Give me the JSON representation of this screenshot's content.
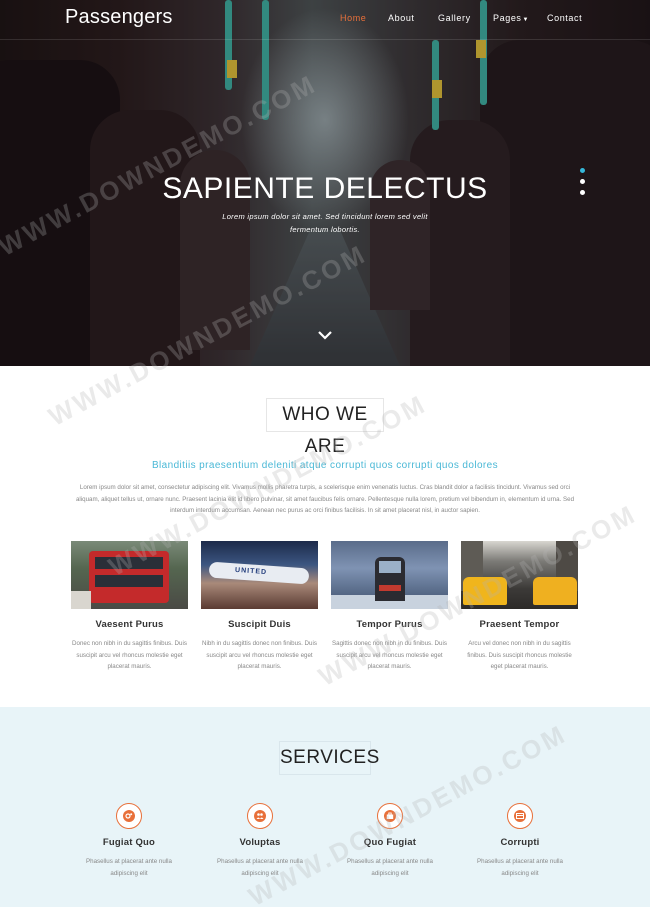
{
  "brand": "Passengers",
  "nav": [
    {
      "label": "Home",
      "active": true
    },
    {
      "label": "About",
      "active": false
    },
    {
      "label": "Gallery",
      "active": false
    },
    {
      "label": "Pages",
      "active": false,
      "has_dropdown": true
    },
    {
      "label": "Contact",
      "active": false
    }
  ],
  "hero": {
    "title": "SAPIENTE DELECTUS",
    "subtitle": "Lorem ipsum dolor sit amet. Sed tincidunt lorem sed velit fermentum lobortis.",
    "slide_dots": 3,
    "active_dot": 0,
    "scroll_icon": "chevron-down-icon"
  },
  "about": {
    "title": "WHO WE ARE",
    "lead": "Blanditiis praesentium deleniti atque corrupti quos corrupti quos dolores",
    "text": "Lorem ipsum dolor sit amet, consectetur adipiscing elit. Vivamus mollis pharetra turpis, a scelerisque enim venenatis luctus. Cras blandit dolor a facilisis tincidunt. Vivamus sed orci aliquam, aliquet tellus ut, ornare nunc. Praesent lacinia elit id libero pulvinar, sit amet faucibus felis ornare. Pellentesque nulla lorem, pretium vel bibendum in, elementum id urna. Sed interdum interdum accumsan. Aenean nec purus ac orci finibus facilisis. In sit amet placerat nisl, in auctor sapien.",
    "cards": [
      {
        "name": "Vaesent Purus",
        "desc": "Donec non nibh in du sagittis finibus. Duis suscipit arcu vel rhoncus molestie eget placerat mauris.",
        "image": "bus"
      },
      {
        "name": "Suscipit Duis",
        "desc": "Nibh in du sagittis donec non finibus. Duis suscipit arcu vel rhoncus molestie eget placerat mauris.",
        "image": "plane",
        "image_text": "UNITED"
      },
      {
        "name": "Tempor Purus",
        "desc": "Sagittis donec non nibh in du finibus. Duis suscipit arcu vel rhoncus molestie eget placerat mauris.",
        "image": "train"
      },
      {
        "name": "Praesent Tempor",
        "desc": "Arcu vel donec non nibh in du sagittis finibus. Duis suscipit rhoncus molestie eget placerat mauris.",
        "image": "taxi"
      }
    ]
  },
  "services": {
    "title": "SERVICES",
    "items": [
      {
        "name": "Fugiat Quo",
        "desc": "Phasellus at placerat ante nulla adipiscing elit",
        "icon": "cogs-icon"
      },
      {
        "name": "Voluptas",
        "desc": "Phasellus at placerat ante nulla adipiscing elit",
        "icon": "users-icon"
      },
      {
        "name": "Quo Fugiat",
        "desc": "Phasellus at placerat ante nulla adipiscing elit",
        "icon": "briefcase-icon"
      },
      {
        "name": "Corrupti",
        "desc": "Phasellus at placerat ante nulla adipiscing elit",
        "icon": "credit-card-icon"
      }
    ]
  },
  "watermark": "WWW.DOWNDEMO.COM",
  "colors": {
    "accent": "#e8703a",
    "lead": "#4ab8d6",
    "services_bg": "#e8f4f8",
    "active_dot": "#35b7d9"
  }
}
